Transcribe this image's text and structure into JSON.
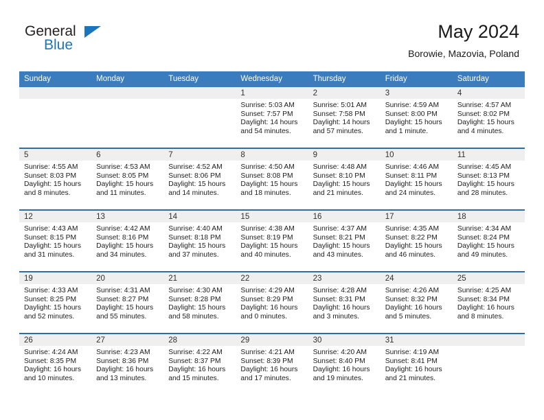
{
  "brand": {
    "name_part1": "General",
    "name_part2": "Blue",
    "accent_color": "#1b75bc"
  },
  "header": {
    "title": "May 2024",
    "location": "Borowie, Mazovia, Poland"
  },
  "calendar": {
    "header_background": "#3a7cbe",
    "row_divider_color": "#2e6da4",
    "daynum_band_color": "#efefef",
    "weekday_labels": [
      "Sunday",
      "Monday",
      "Tuesday",
      "Wednesday",
      "Thursday",
      "Friday",
      "Saturday"
    ],
    "weeks": [
      [
        {
          "day": "",
          "empty": true
        },
        {
          "day": "",
          "empty": true
        },
        {
          "day": "",
          "empty": true
        },
        {
          "day": "1",
          "sunrise": "Sunrise: 5:03 AM",
          "sunset": "Sunset: 7:57 PM",
          "daylight_line1": "Daylight: 14 hours",
          "daylight_line2": "and 54 minutes."
        },
        {
          "day": "2",
          "sunrise": "Sunrise: 5:01 AM",
          "sunset": "Sunset: 7:58 PM",
          "daylight_line1": "Daylight: 14 hours",
          "daylight_line2": "and 57 minutes."
        },
        {
          "day": "3",
          "sunrise": "Sunrise: 4:59 AM",
          "sunset": "Sunset: 8:00 PM",
          "daylight_line1": "Daylight: 15 hours",
          "daylight_line2": "and 1 minute."
        },
        {
          "day": "4",
          "sunrise": "Sunrise: 4:57 AM",
          "sunset": "Sunset: 8:02 PM",
          "daylight_line1": "Daylight: 15 hours",
          "daylight_line2": "and 4 minutes."
        }
      ],
      [
        {
          "day": "5",
          "sunrise": "Sunrise: 4:55 AM",
          "sunset": "Sunset: 8:03 PM",
          "daylight_line1": "Daylight: 15 hours",
          "daylight_line2": "and 8 minutes."
        },
        {
          "day": "6",
          "sunrise": "Sunrise: 4:53 AM",
          "sunset": "Sunset: 8:05 PM",
          "daylight_line1": "Daylight: 15 hours",
          "daylight_line2": "and 11 minutes."
        },
        {
          "day": "7",
          "sunrise": "Sunrise: 4:52 AM",
          "sunset": "Sunset: 8:06 PM",
          "daylight_line1": "Daylight: 15 hours",
          "daylight_line2": "and 14 minutes."
        },
        {
          "day": "8",
          "sunrise": "Sunrise: 4:50 AM",
          "sunset": "Sunset: 8:08 PM",
          "daylight_line1": "Daylight: 15 hours",
          "daylight_line2": "and 18 minutes."
        },
        {
          "day": "9",
          "sunrise": "Sunrise: 4:48 AM",
          "sunset": "Sunset: 8:10 PM",
          "daylight_line1": "Daylight: 15 hours",
          "daylight_line2": "and 21 minutes."
        },
        {
          "day": "10",
          "sunrise": "Sunrise: 4:46 AM",
          "sunset": "Sunset: 8:11 PM",
          "daylight_line1": "Daylight: 15 hours",
          "daylight_line2": "and 24 minutes."
        },
        {
          "day": "11",
          "sunrise": "Sunrise: 4:45 AM",
          "sunset": "Sunset: 8:13 PM",
          "daylight_line1": "Daylight: 15 hours",
          "daylight_line2": "and 28 minutes."
        }
      ],
      [
        {
          "day": "12",
          "sunrise": "Sunrise: 4:43 AM",
          "sunset": "Sunset: 8:15 PM",
          "daylight_line1": "Daylight: 15 hours",
          "daylight_line2": "and 31 minutes."
        },
        {
          "day": "13",
          "sunrise": "Sunrise: 4:42 AM",
          "sunset": "Sunset: 8:16 PM",
          "daylight_line1": "Daylight: 15 hours",
          "daylight_line2": "and 34 minutes."
        },
        {
          "day": "14",
          "sunrise": "Sunrise: 4:40 AM",
          "sunset": "Sunset: 8:18 PM",
          "daylight_line1": "Daylight: 15 hours",
          "daylight_line2": "and 37 minutes."
        },
        {
          "day": "15",
          "sunrise": "Sunrise: 4:38 AM",
          "sunset": "Sunset: 8:19 PM",
          "daylight_line1": "Daylight: 15 hours",
          "daylight_line2": "and 40 minutes."
        },
        {
          "day": "16",
          "sunrise": "Sunrise: 4:37 AM",
          "sunset": "Sunset: 8:21 PM",
          "daylight_line1": "Daylight: 15 hours",
          "daylight_line2": "and 43 minutes."
        },
        {
          "day": "17",
          "sunrise": "Sunrise: 4:35 AM",
          "sunset": "Sunset: 8:22 PM",
          "daylight_line1": "Daylight: 15 hours",
          "daylight_line2": "and 46 minutes."
        },
        {
          "day": "18",
          "sunrise": "Sunrise: 4:34 AM",
          "sunset": "Sunset: 8:24 PM",
          "daylight_line1": "Daylight: 15 hours",
          "daylight_line2": "and 49 minutes."
        }
      ],
      [
        {
          "day": "19",
          "sunrise": "Sunrise: 4:33 AM",
          "sunset": "Sunset: 8:25 PM",
          "daylight_line1": "Daylight: 15 hours",
          "daylight_line2": "and 52 minutes."
        },
        {
          "day": "20",
          "sunrise": "Sunrise: 4:31 AM",
          "sunset": "Sunset: 8:27 PM",
          "daylight_line1": "Daylight: 15 hours",
          "daylight_line2": "and 55 minutes."
        },
        {
          "day": "21",
          "sunrise": "Sunrise: 4:30 AM",
          "sunset": "Sunset: 8:28 PM",
          "daylight_line1": "Daylight: 15 hours",
          "daylight_line2": "and 58 minutes."
        },
        {
          "day": "22",
          "sunrise": "Sunrise: 4:29 AM",
          "sunset": "Sunset: 8:29 PM",
          "daylight_line1": "Daylight: 16 hours",
          "daylight_line2": "and 0 minutes."
        },
        {
          "day": "23",
          "sunrise": "Sunrise: 4:28 AM",
          "sunset": "Sunset: 8:31 PM",
          "daylight_line1": "Daylight: 16 hours",
          "daylight_line2": "and 3 minutes."
        },
        {
          "day": "24",
          "sunrise": "Sunrise: 4:26 AM",
          "sunset": "Sunset: 8:32 PM",
          "daylight_line1": "Daylight: 16 hours",
          "daylight_line2": "and 5 minutes."
        },
        {
          "day": "25",
          "sunrise": "Sunrise: 4:25 AM",
          "sunset": "Sunset: 8:34 PM",
          "daylight_line1": "Daylight: 16 hours",
          "daylight_line2": "and 8 minutes."
        }
      ],
      [
        {
          "day": "26",
          "sunrise": "Sunrise: 4:24 AM",
          "sunset": "Sunset: 8:35 PM",
          "daylight_line1": "Daylight: 16 hours",
          "daylight_line2": "and 10 minutes."
        },
        {
          "day": "27",
          "sunrise": "Sunrise: 4:23 AM",
          "sunset": "Sunset: 8:36 PM",
          "daylight_line1": "Daylight: 16 hours",
          "daylight_line2": "and 13 minutes."
        },
        {
          "day": "28",
          "sunrise": "Sunrise: 4:22 AM",
          "sunset": "Sunset: 8:37 PM",
          "daylight_line1": "Daylight: 16 hours",
          "daylight_line2": "and 15 minutes."
        },
        {
          "day": "29",
          "sunrise": "Sunrise: 4:21 AM",
          "sunset": "Sunset: 8:39 PM",
          "daylight_line1": "Daylight: 16 hours",
          "daylight_line2": "and 17 minutes."
        },
        {
          "day": "30",
          "sunrise": "Sunrise: 4:20 AM",
          "sunset": "Sunset: 8:40 PM",
          "daylight_line1": "Daylight: 16 hours",
          "daylight_line2": "and 19 minutes."
        },
        {
          "day": "31",
          "sunrise": "Sunrise: 4:19 AM",
          "sunset": "Sunset: 8:41 PM",
          "daylight_line1": "Daylight: 16 hours",
          "daylight_line2": "and 21 minutes."
        },
        {
          "day": "",
          "empty": true
        }
      ]
    ]
  }
}
